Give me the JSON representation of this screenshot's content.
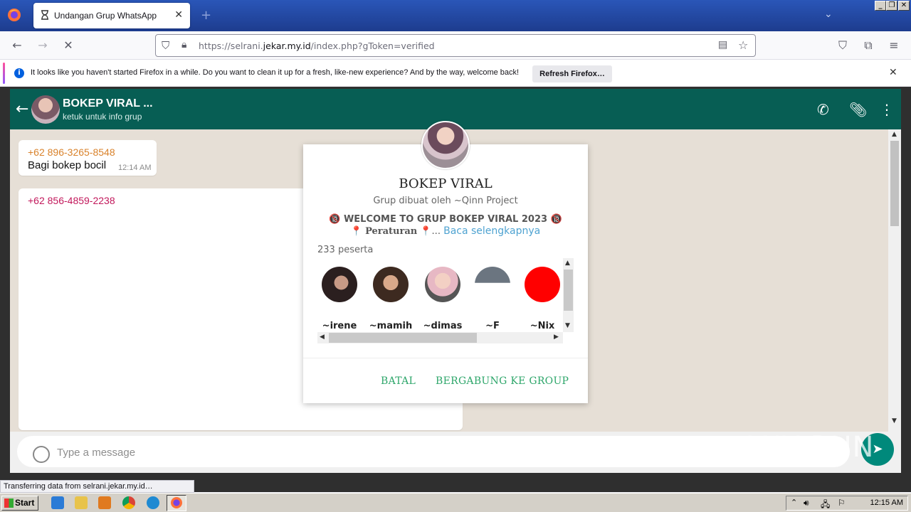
{
  "browser": {
    "tab_title": "Undangan Grup WhatsApp",
    "url_prefix": "https://selrani.",
    "url_domain": "jekar.my.id",
    "url_path": "/index.php?gToken=verified",
    "notification": {
      "message": "It looks like you haven't started Firefox in a while. Do you want to clean it up for a fresh, like-new experience? And by the way, welcome back!",
      "button": "Refresh Firefox…"
    },
    "status_text": "Transferring data from selrani.jekar.my.id…"
  },
  "whatsapp": {
    "group_name": "BOKEP VIRAL ...",
    "group_subtitle": "ketuk untuk info grup",
    "messages": [
      {
        "sender": "+62 896-3265-8548",
        "text": "Bagi bokep bocil",
        "time": "12:14 AM",
        "sender_color": "#d9822b"
      },
      {
        "sender": "+62 856-4859-2238",
        "text": "",
        "time": "",
        "sender_color": "#c2185b"
      }
    ],
    "composer_placeholder": "Type a message"
  },
  "modal": {
    "group_name": "BOKEP VIRAL",
    "creator": "Grup dibuat oleh ~Qinn Project",
    "welcome": "🔞 WELCOME TO GRUP BOKEP VIRAL 2023 🔞",
    "rules_prefix": "📍 ",
    "rules_label": "Peraturan",
    "rules_suffix": " 📍... ",
    "read_more": "Baca selengkapnya",
    "participants": "233 peserta",
    "members": [
      {
        "name": "~irene",
        "color": "#3b2a2a"
      },
      {
        "name": "~mamih",
        "color": "#4a3326"
      },
      {
        "name": "~dimas",
        "color": "#d8a7b5"
      },
      {
        "name": "~F",
        "color": "#b9c1c6"
      },
      {
        "name": "~Nix",
        "color": "#ff0000"
      }
    ],
    "cancel": "BATAL",
    "join": "BERGABUNG KE GROUP"
  },
  "watermark": "ANY RUN",
  "taskbar": {
    "start": "Start",
    "clock": "12:15 AM"
  },
  "colors": {
    "wa_header": "#075e54",
    "button_green": "#2da66a",
    "link_blue": "#4fa3d1"
  }
}
